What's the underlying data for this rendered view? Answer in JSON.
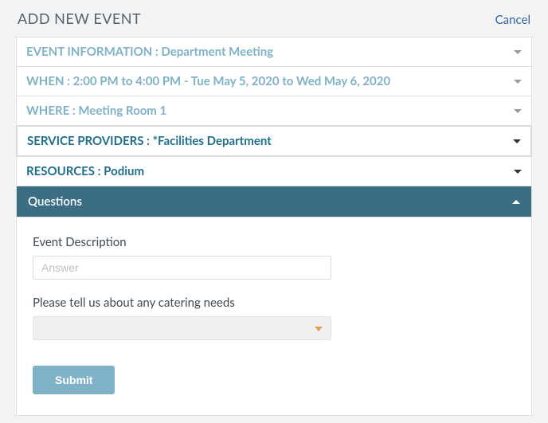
{
  "header": {
    "title": "ADD NEW EVENT",
    "cancel": "Cancel"
  },
  "sections": {
    "event_info": "EVENT INFORMATION : Department Meeting",
    "when": "WHEN : 2:00 PM to 4:00 PM - Tue May 5, 2020 to Wed May 6, 2020",
    "where": "WHERE : Meeting Room 1",
    "service_providers": "SERVICE PROVIDERS : *Facilities Department",
    "resources": "RESOURCES : Podium",
    "questions": "Questions"
  },
  "questions_panel": {
    "desc_label": "Event Description",
    "desc_placeholder": "Answer",
    "catering_label": "Please tell us about any catering needs",
    "submit": "Submit"
  }
}
